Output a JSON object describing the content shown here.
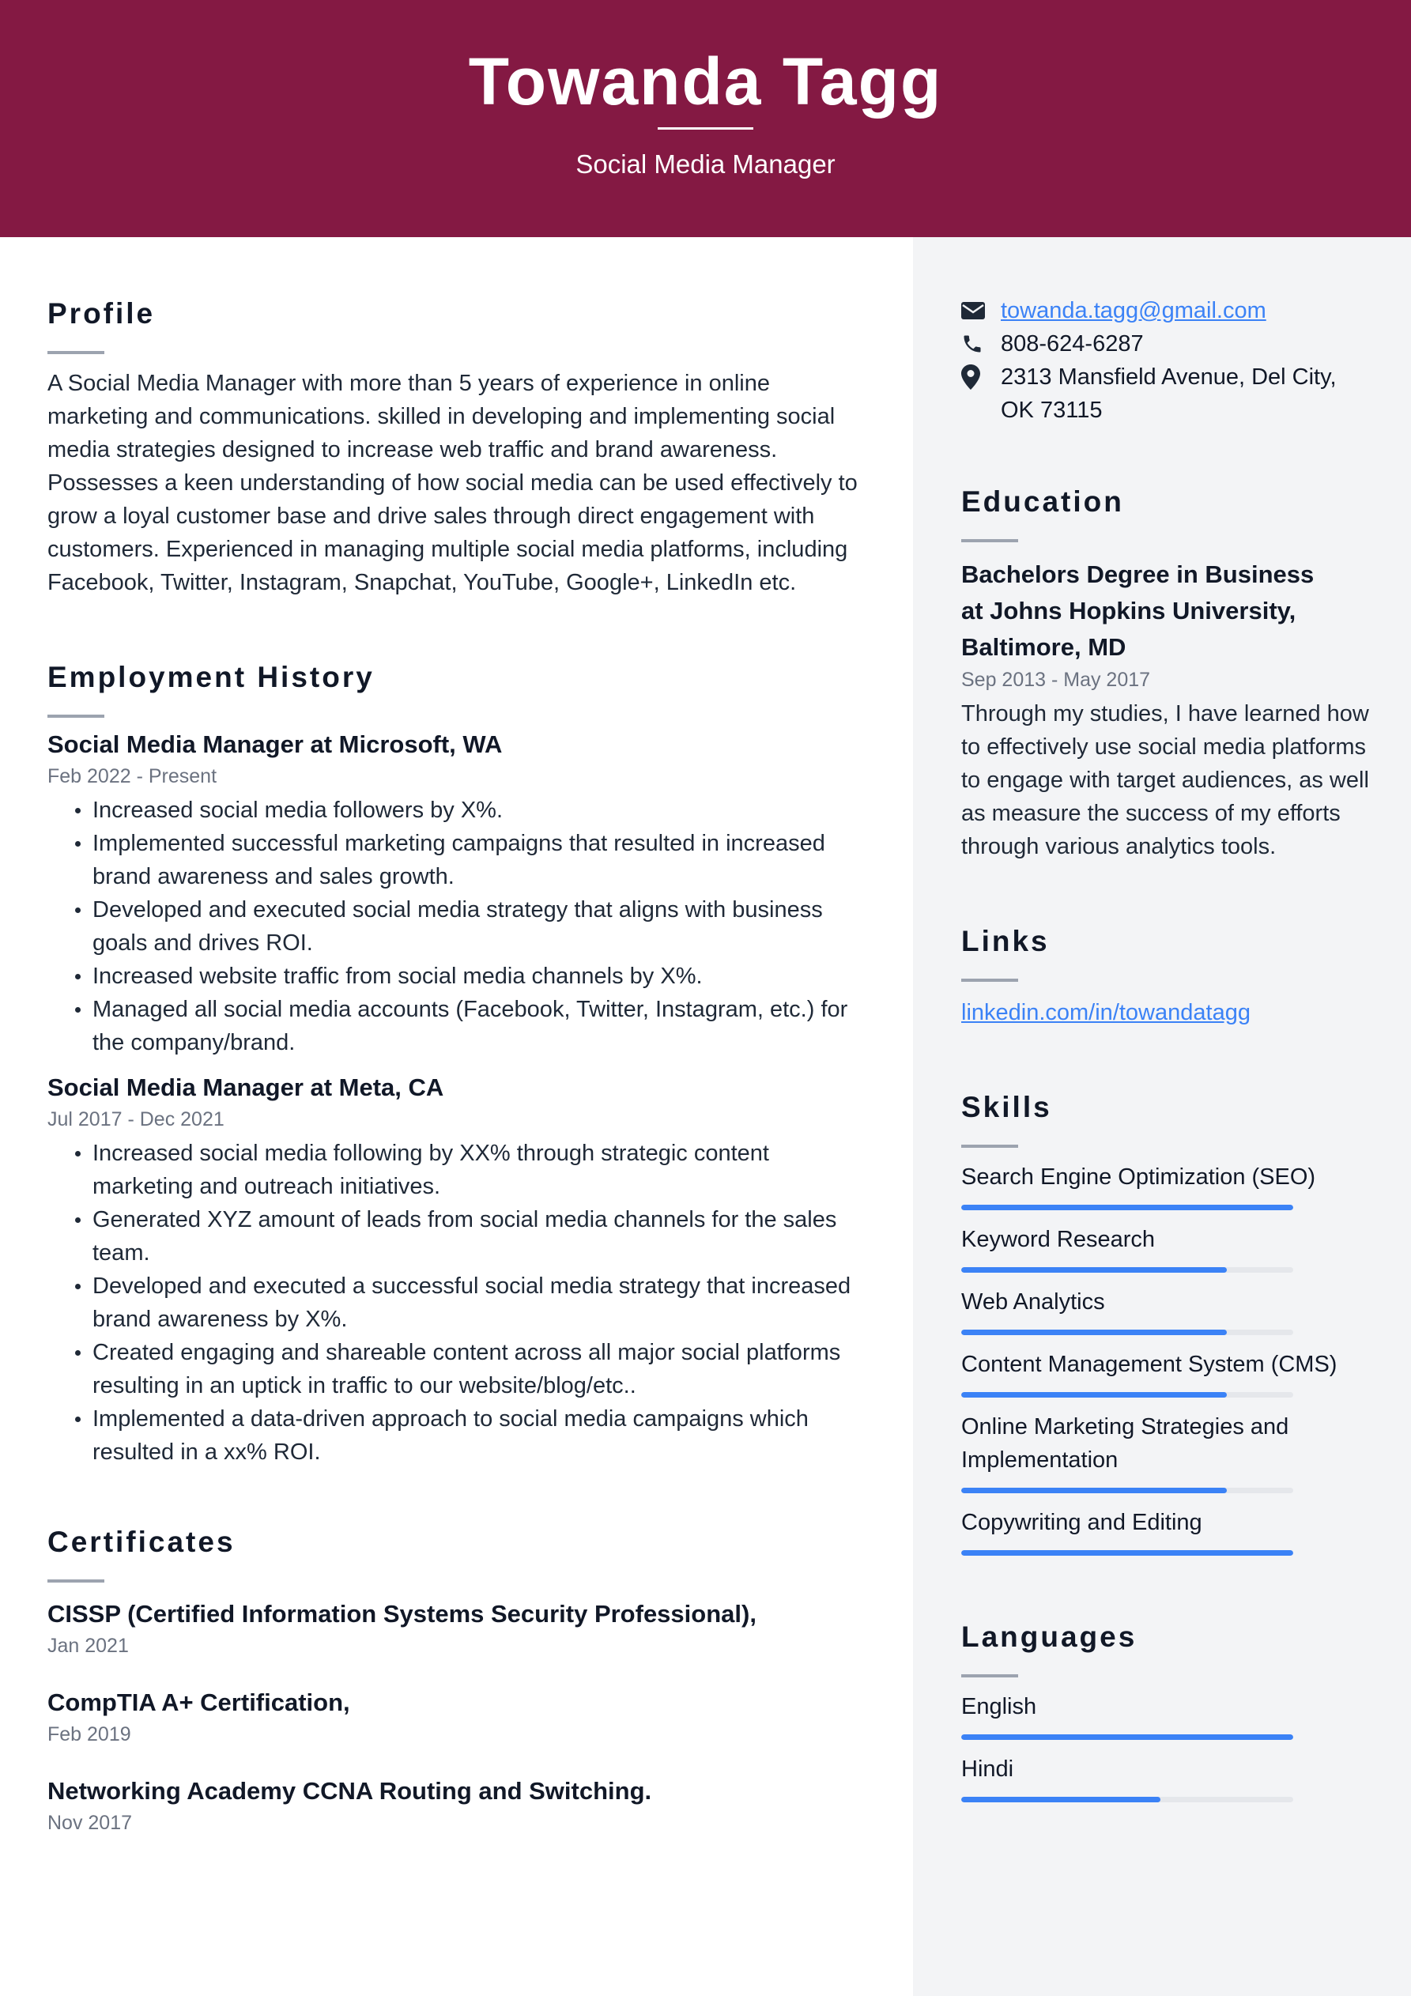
{
  "header": {
    "name": "Towanda Tagg",
    "title": "Social Media Manager",
    "background_color": "#841943"
  },
  "profile": {
    "heading": "Profile",
    "text": "A Social Media Manager with more than 5 years of experience in online marketing and communications. skilled in developing and implementing social media strategies designed to increase web traffic and brand awareness. Possesses a keen understanding of how social media can be used effectively to grow a loyal customer base and drive sales through direct engagement with customers. Experienced in managing multiple social media platforms, including Facebook, Twitter, Instagram, Snapchat, YouTube, Google+, LinkedIn etc."
  },
  "employment": {
    "heading": "Employment History",
    "jobs": [
      {
        "title": "Social Media Manager at Microsoft, WA",
        "dates": "Feb 2022 - Present",
        "bullets": [
          "Increased social media followers by X%.",
          "Implemented successful marketing campaigns that resulted in increased brand awareness and sales growth.",
          "Developed and executed social media strategy that aligns with business goals and drives ROI.",
          "Increased website traffic from social media channels by X%.",
          "Managed all social media accounts (Facebook, Twitter, Instagram, etc.) for the company/brand."
        ]
      },
      {
        "title": "Social Media Manager at Meta, CA",
        "dates": "Jul 2017 - Dec 2021",
        "bullets": [
          "Increased social media following by XX% through strategic content marketing and outreach initiatives.",
          "Generated XYZ amount of leads from social media channels for the sales team.",
          "Developed and executed a successful social media strategy that increased brand awareness by X%.",
          "Created engaging and shareable content across all major social platforms resulting in an uptick in traffic to our website/blog/etc..",
          "Implemented a data-driven approach to social media campaigns which resulted in a xx% ROI."
        ]
      }
    ]
  },
  "certificates": {
    "heading": "Certificates",
    "items": [
      {
        "title": "CISSP (Certified Information Systems Security Professional),",
        "date": "Jan 2021"
      },
      {
        "title": "CompTIA A+ Certification,",
        "date": "Feb 2019"
      },
      {
        "title": "Networking Academy CCNA Routing and Switching.",
        "date": "Nov 2017"
      }
    ]
  },
  "contact": {
    "email": "towanda.tagg@gmail.com",
    "phone": "808-624-6287",
    "address": "2313 Mansfield Avenue, Del City, OK 73115",
    "icons": [
      "envelope-icon",
      "phone-icon",
      "map-pin-icon"
    ]
  },
  "education": {
    "heading": "Education",
    "degree": "Bachelors Degree in Business at Johns Hopkins University, Baltimore, MD",
    "dates": "Sep 2013 - May 2017",
    "description": "Through my studies, I have learned how to effectively use social media platforms to engage with target audiences, as well as measure the success of my efforts through various analytics tools."
  },
  "links": {
    "heading": "Links",
    "items": [
      {
        "label": "linkedin.com/in/towandatagg"
      }
    ]
  },
  "skills": {
    "heading": "Skills",
    "bar_color": "#3b82f6",
    "items": [
      {
        "label": "Search Engine Optimization (SEO)",
        "level": 1.0
      },
      {
        "label": "Keyword Research",
        "level": 0.8
      },
      {
        "label": "Web Analytics",
        "level": 0.8
      },
      {
        "label": "Content Management System (CMS)",
        "level": 0.8
      },
      {
        "label": "Online Marketing Strategies and Implementation",
        "level": 0.8
      },
      {
        "label": "Copywriting and Editing",
        "level": 1.0
      }
    ]
  },
  "languages": {
    "heading": "Languages",
    "items": [
      {
        "label": "English",
        "level": 1.0
      },
      {
        "label": "Hindi",
        "level": 0.6
      }
    ]
  }
}
